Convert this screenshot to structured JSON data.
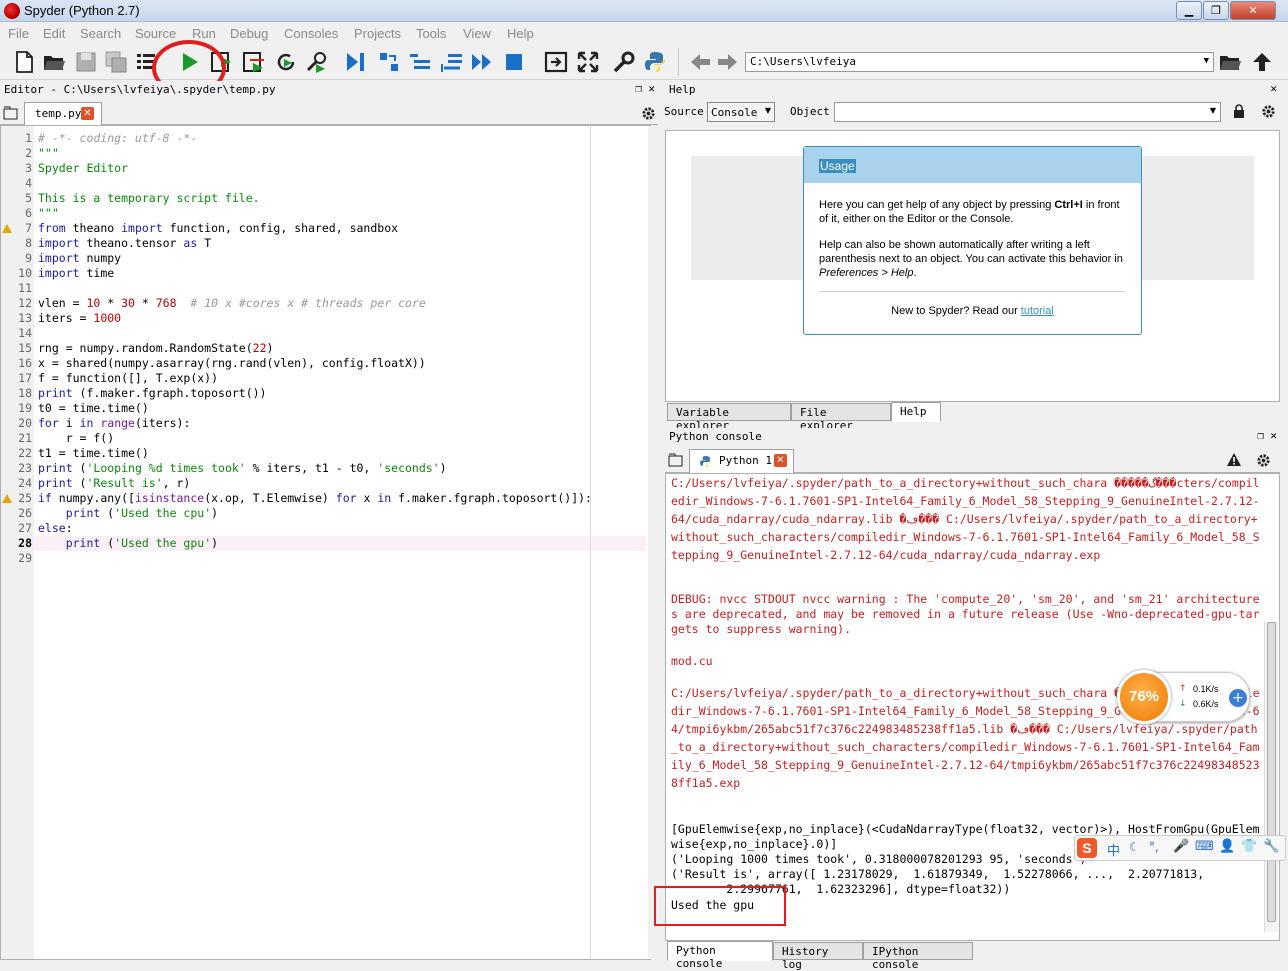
{
  "window": {
    "title": "Spyder (Python 2.7)"
  },
  "menu": [
    "File",
    "Edit",
    "Search",
    "Source",
    "Run",
    "Debug",
    "Consoles",
    "Projects",
    "Tools",
    "View",
    "Help"
  ],
  "toolbar": {
    "path": "C:\\Users\\lvfeiya"
  },
  "editor": {
    "pane_title": "Editor - C:\\Users\\lvfeiya\\.spyder\\temp.py",
    "tab": "temp.py",
    "lines": [
      "# -*- coding: utf-8 -*-",
      "\"\"\"",
      "Spyder Editor",
      "",
      "This is a temporary script file.",
      "\"\"\"",
      "from theano import function, config, shared, sandbox",
      "import theano.tensor as T",
      "import numpy",
      "import time",
      "",
      "vlen = 10 * 30 * 768  # 10 x #cores x # threads per core",
      "iters = 1000",
      "",
      "rng = numpy.random.RandomState(22)",
      "x = shared(numpy.asarray(rng.rand(vlen), config.floatX))",
      "f = function([], T.exp(x))",
      "print (f.maker.fgraph.toposort())",
      "t0 = time.time()",
      "for i in range(iters):",
      "    r = f()",
      "t1 = time.time()",
      "print ('Looping %d times took' % iters, t1 - t0, 'seconds')",
      "print ('Result is', r)",
      "if numpy.any([isinstance(x.op, T.Elemwise) for x in f.maker.fgraph.toposort()]):",
      "    print ('Used the cpu')",
      "else:",
      "    print ('Used the gpu')",
      ""
    ]
  },
  "help": {
    "pane_title": "Help",
    "source_label": "Source",
    "source_value": "Console",
    "object_label": "Object",
    "usage_title": "Usage",
    "usage_p1_a": "Here you can get help of any object by pressing ",
    "usage_p1_b": "Ctrl+I",
    "usage_p1_c": " in front of it, either on the Editor or the Console.",
    "usage_p2_a": "Help can also be shown automatically after writing a left parenthesis next to an object. You can activate this behavior in ",
    "usage_p2_b": "Preferences > Help",
    "usage_p2_c": ".",
    "usage_new": "New to Spyder? Read our ",
    "usage_link": "tutorial",
    "tabs": [
      "Variable explorer",
      "File explorer",
      "Help"
    ]
  },
  "console": {
    "pane_title": "Python console",
    "tab": "Python 1",
    "out1": "C:/Users/lvfeiya/.spyder/path_to_a_directory+without_such_chara �����گ���cters/compiledir_Windows-7-6.1.7601-SP1-Intel64_Family_6_Model_58_Stepping_9_GenuineIntel-2.7.12-64/cuda_ndarray/cuda_ndarray.lib �ڡ��� C:/Users/lvfeiya/.spyder/path_to_a_directory+without_such_characters/compiledir_Windows-7-6.1.7601-SP1-Intel64_Family_6_Model_58_Stepping_9_GenuineIntel-2.7.12-64/cuda_ndarray/cuda_ndarray.exp",
    "out2": "DEBUG: nvcc STDOUT nvcc warning : The 'compute_20', 'sm_20', and 'sm_21' architectures are deprecated, and may be removed in a future release (Use -Wno-deprecated-gpu-targets to suppress warning).",
    "out3": "mod.cu",
    "out4": "C:/Users/lvfeiya/.spyder/path_to_a_directory+without_such_chara ����گ���cters/compiledir_Windows-7-6.1.7601-SP1-Intel64_Family_6_Model_58_Stepping_9_GenuineIntel-2.7.12-64/tmpi6ykbm/265abc51f7c376c224983485238ff1a5.lib �ڡ��� C:/Users/lvfeiya/.spyder/path_to_a_directory+without_such_characters/compiledir_Windows-7-6.1.7601-SP1-Intel64_Family_6_Model_58_Stepping_9_GenuineIntel-2.7.12-64/tmpi6ykbm/265abc51f7c376c224983485238ff1a5.exp",
    "out5": "[GpuElemwise{exp,no_inplace}(<CudaNdarrayType(float32, vector)>), HostFromGpu(GpuElemwise{exp,no_inplace}.0)]",
    "out6": "('Looping 1000 times took', 0.318000078201293 95, 'seconds')",
    "out7": "('Result is', array([ 1.23178029,  1.61879349,  1.52278066, ...,  2.20771813,\n        2.29967761,  1.62323296], dtype=float32))",
    "out8": "Used the gpu",
    "tabs": [
      "Python console",
      "History log",
      "IPython console"
    ]
  },
  "overlay": {
    "percent": "76%",
    "up": "0.1K/s",
    "down": "0.6K/s",
    "ime_char": "中"
  },
  "colors": {
    "accent": "#3a8ec0",
    "error_text": "#c91e1e",
    "highlight": "#e21d1d"
  }
}
